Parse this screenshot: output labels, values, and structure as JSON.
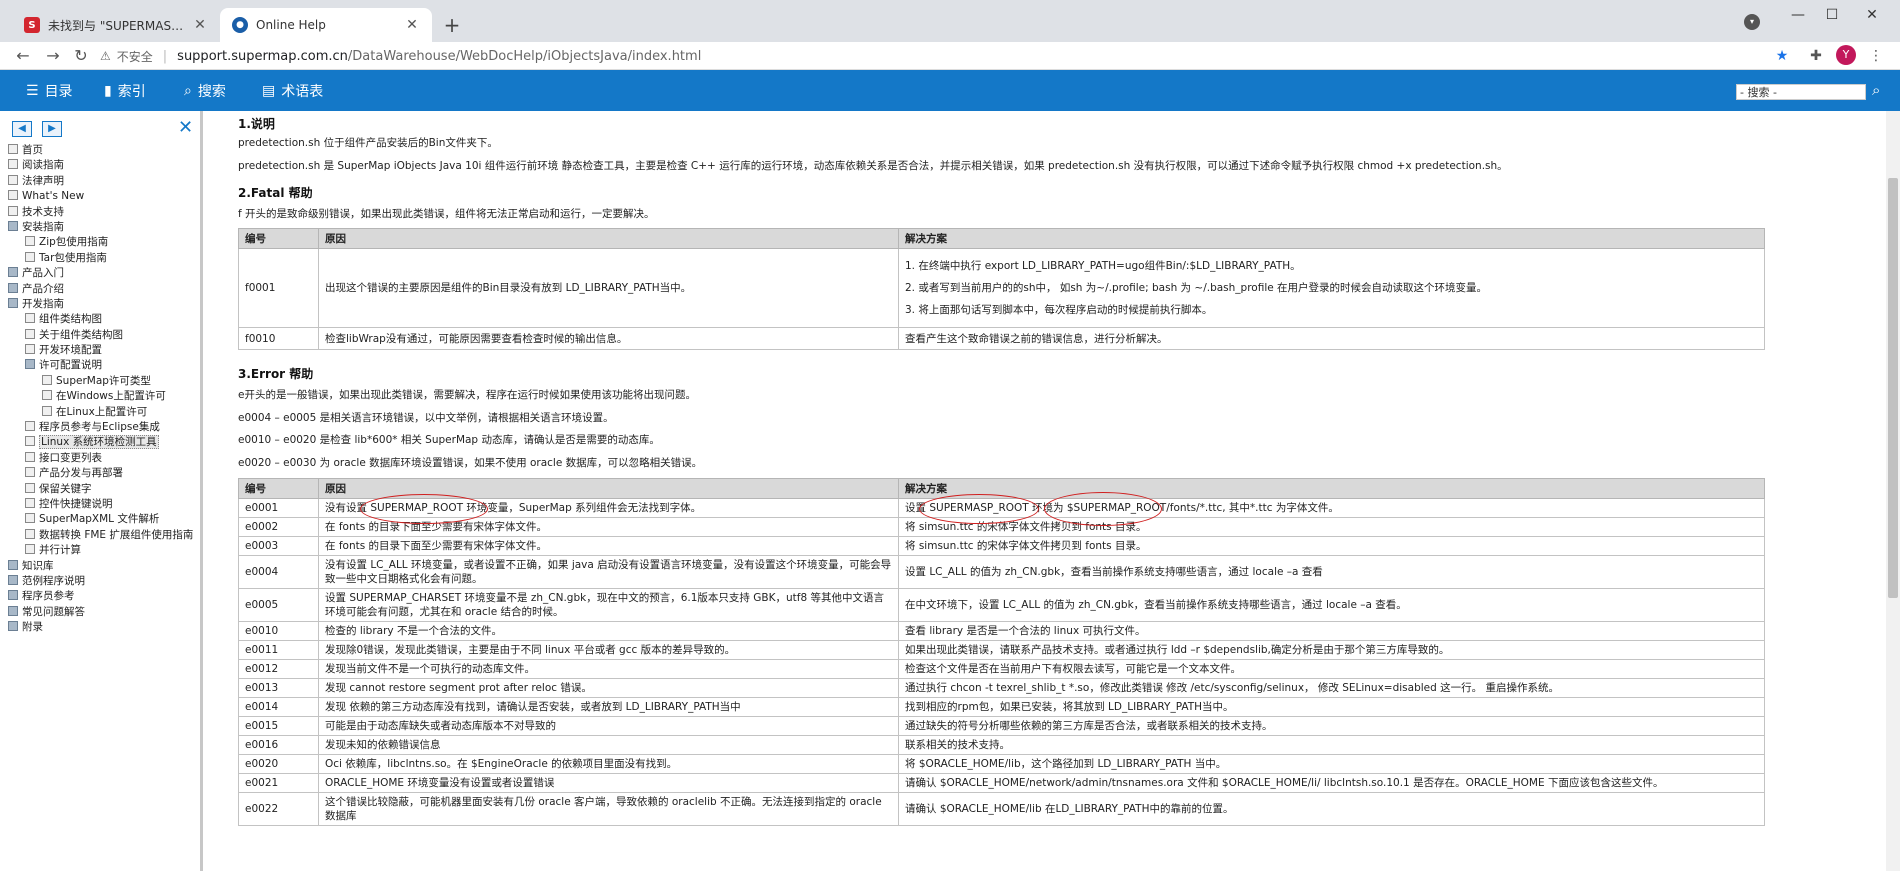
{
  "browser": {
    "tabs": [
      {
        "title": "未找到与 \"SUPERMASP_ROOT\"",
        "favicon": "S",
        "active": false
      },
      {
        "title": "Online Help",
        "favicon": "globe",
        "active": true
      }
    ],
    "new_tab": "+",
    "address": {
      "warning": "⚠",
      "not_secure": "不安全",
      "host": "support.supermap.com.cn",
      "path": "/DataWarehouse/WebDocHelp/iObjectsJava/index.html"
    },
    "avatar": "Y"
  },
  "helpbar": {
    "items": [
      {
        "icon": "☰",
        "label": "目录"
      },
      {
        "icon": "▮",
        "label": "索引"
      },
      {
        "icon": "⌕",
        "label": "搜索"
      },
      {
        "icon": "▤",
        "label": "术语表"
      }
    ],
    "search_value": "- 搜索 -"
  },
  "toc": {
    "items": [
      {
        "label": "首页",
        "level": 0,
        "type": "page"
      },
      {
        "label": "阅读指南",
        "level": 0,
        "type": "page"
      },
      {
        "label": "法律声明",
        "level": 0,
        "type": "page"
      },
      {
        "label": "What's New",
        "level": 0,
        "type": "page"
      },
      {
        "label": "技术支持",
        "level": 0,
        "type": "page"
      },
      {
        "label": "安装指南",
        "level": 0,
        "type": "book"
      },
      {
        "label": "Zip包使用指南",
        "level": 1,
        "type": "page"
      },
      {
        "label": "Tar包使用指南",
        "level": 1,
        "type": "page"
      },
      {
        "label": "产品入门",
        "level": 0,
        "type": "book"
      },
      {
        "label": "产品介绍",
        "level": 0,
        "type": "book"
      },
      {
        "label": "开发指南",
        "level": 0,
        "type": "book"
      },
      {
        "label": "组件类结构图",
        "level": 1,
        "type": "page"
      },
      {
        "label": "关于组件类结构图",
        "level": 1,
        "type": "page"
      },
      {
        "label": "开发环境配置",
        "level": 1,
        "type": "page"
      },
      {
        "label": "许可配置说明",
        "level": 1,
        "type": "book"
      },
      {
        "label": "SuperMap许可类型",
        "level": 2,
        "type": "page"
      },
      {
        "label": "在Windows上配置许可",
        "level": 2,
        "type": "page"
      },
      {
        "label": "在Linux上配置许可",
        "level": 2,
        "type": "page"
      },
      {
        "label": "程序员参考与Eclipse集成",
        "level": 1,
        "type": "page"
      },
      {
        "label": "Linux 系统环境检测工具",
        "level": 1,
        "type": "page",
        "selected": true
      },
      {
        "label": "接口变更列表",
        "level": 1,
        "type": "page"
      },
      {
        "label": "产品分发与再部署",
        "level": 1,
        "type": "page"
      },
      {
        "label": "保留关键字",
        "level": 1,
        "type": "page"
      },
      {
        "label": "控件快捷键说明",
        "level": 1,
        "type": "page"
      },
      {
        "label": "SuperMapXML 文件解析",
        "level": 1,
        "type": "page"
      },
      {
        "label": "数据转换 FME 扩展组件使用指南",
        "level": 1,
        "type": "page"
      },
      {
        "label": "并行计算",
        "level": 1,
        "type": "page"
      },
      {
        "label": "知识库",
        "level": 0,
        "type": "book"
      },
      {
        "label": "范例程序说明",
        "level": 0,
        "type": "book"
      },
      {
        "label": "程序员参考",
        "level": 0,
        "type": "book"
      },
      {
        "label": "常见问题解答",
        "level": 0,
        "type": "book"
      },
      {
        "label": "附录",
        "level": 0,
        "type": "book"
      }
    ]
  },
  "content": {
    "section1": {
      "heading": "1.说明",
      "p1": "predetection.sh 位于组件产品安装后的Bin文件夹下。",
      "p2": "predetection.sh 是 SuperMap iObjects Java 10i 组件运行前环境 静态检查工具，主要是检查 C++ 运行库的运行环境，动态库依赖关系是否合法，并提示相关错误，如果 predetection.sh 没有执行权限，可以通过下述命令赋予执行权限 chmod +x predetection.sh。"
    },
    "section2": {
      "heading": "2.Fatal 帮助",
      "p1": "f 开头的是致命级别错误，如果出现此类错误，组件将无法正常启动和运行，一定要解决。",
      "headers": [
        "编号",
        "原因",
        "解决方案"
      ],
      "rows": [
        {
          "code": "f0001",
          "reason": "出现这个错误的主要原因是组件的Bin目录没有放到 LD_LIBRARY_PATH当中。",
          "solutions": [
            "1. 在终端中执行 export LD_LIBRARY_PATH=ugo组件Bin/:$LD_LIBRARY_PATH。",
            "2. 或者写到当前用户的的sh中， 如sh 为~/.profile; bash 为 ~/.bash_profile 在用户登录的时候会自动读取这个环境变量。",
            "3. 将上面那句话写到脚本中，每次程序启动的时候提前执行脚本。"
          ]
        },
        {
          "code": "f0010",
          "reason": "检查libWrap没有通过，可能原因需要查看检查时候的输出信息。",
          "solutions": [
            "查看产生这个致命错误之前的错误信息，进行分析解决。"
          ]
        }
      ]
    },
    "section3": {
      "heading": "3.Error 帮助",
      "p1": "e开头的是一般错误，如果出现此类错误，需要解决，程序在运行时候如果使用该功能将出现问题。",
      "p2": "e0004 – e0005 是相关语言环境错误，以中文举例，请根据相关语言环境设置。",
      "p3": "e0010 – e0020 是检查 lib*600* 相关 SuperMap 动态库，请确认是否是需要的动态库。",
      "p4": "e0020 – e0030 为 oracle 数据库环境设置错误，如果不使用 oracle 数据库，可以忽略相关错误。",
      "headers": [
        "编号",
        "原因",
        "解决方案"
      ],
      "rows": [
        {
          "code": "e0001",
          "reason": "没有设置 SUPERMAP_ROOT 环境变量，SuperMap 系列组件会无法找到字体。",
          "solution": "设置 SUPERMASP_ROOT 环境为 $SUPERMAP_ROOT/fonts/*.ttc, 其中*.ttc 为字体文件。"
        },
        {
          "code": "e0002",
          "reason": "在 fonts 的目录下面至少需要有宋体字体文件。",
          "solution": "将 simsun.ttc 的宋体字体文件拷贝到 fonts 目录。"
        },
        {
          "code": "e0003",
          "reason": "在 fonts 的目录下面至少需要有宋体字体文件。",
          "solution": "将 simsun.ttc 的宋体字体文件拷贝到 fonts 目录。"
        },
        {
          "code": "e0004",
          "reason": "没有设置 LC_ALL 环境变量，或者设置不正确，如果 java 启动没有设置语言环境变量，没有设置这个环境变量，可能会导致一些中文日期格式化会有问题。",
          "solution": "设置 LC_ALL 的值为 zh_CN.gbk，查看当前操作系统支持哪些语言，通过 locale –a 查看"
        },
        {
          "code": "e0005",
          "reason": "设置 SUPERMAP_CHARSET 环境变量不是 zh_CN.gbk，现在中文的预言，6.1版本只支持 GBK，utf8 等其他中文语言环境可能会有问题，尤其在和 oracle 结合的时候。",
          "solution": "在中文环境下，设置 LC_ALL 的值为 zh_CN.gbk，查看当前操作系统支持哪些语言，通过 locale –a 查看。"
        },
        {
          "code": "e0010",
          "reason": "检查的 library 不是一个合法的文件。",
          "solution": "查看 library 是否是一个合法的 linux 可执行文件。"
        },
        {
          "code": "e0011",
          "reason": "发现除0错误，发现此类错误，主要是由于不同 linux 平台或者 gcc 版本的差异导致的。",
          "solution": "如果出现此类错误，请联系产品技术支持。或者通过执行 ldd –r $dependslib,确定分析是由于那个第三方库导致的。"
        },
        {
          "code": "e0012",
          "reason": "发现当前文件不是一个可执行的动态库文件。",
          "solution": "检查这个文件是否在当前用户下有权限去读写，可能它是一个文本文件。"
        },
        {
          "code": "e0013",
          "reason": "发现 cannot restore segment prot after reloc 错误。",
          "solution": "通过执行 chcon -t texrel_shlib_t *.so，修改此类错误 修改 /etc/sysconfig/selinux， 修改 SELinux=disabled 这一行。 重启操作系统。"
        },
        {
          "code": "e0014",
          "reason": "发现 依赖的第三方动态库没有找到，请确认是否安装，或者放到 LD_LIBRARY_PATH当中",
          "solution": "找到相应的rpm包，如果已安装，将其放到 LD_LIBRARY_PATH当中。"
        },
        {
          "code": "e0015",
          "reason": "可能是由于动态库缺失或者动态库版本不对导致的",
          "solution": "通过缺失的符号分析哪些依赖的第三方库是否合法，或者联系相关的技术支持。"
        },
        {
          "code": "e0016",
          "reason": "发现未知的依赖错误信息",
          "solution": "联系相关的技术支持。"
        },
        {
          "code": "e0020",
          "reason": "Oci 依赖库，libclntns.so。在 $EngineOracle 的依赖项目里面没有找到。",
          "solution": "将 $ORACLE_HOME/lib，这个路径加到 LD_LIBRARY_PATH 当中。"
        },
        {
          "code": "e0021",
          "reason": "ORACLE_HOME 环境变量没有设置或者设置错误",
          "solution": "请确认 $ORACLE_HOME/network/admin/tnsnames.ora 文件和 $ORACLE_HOME/li/ libclntsh.so.10.1 是否存在。ORACLE_HOME 下面应该包含这些文件。"
        },
        {
          "code": "e0022",
          "reason": "这个错误比较隐蔽，可能机器里面安装有几份 oracle 客户端，导致依赖的 oraclelib 不正确。无法连接到指定的 oracle 数据库",
          "solution": "请确认 $ORACLE_HOME/lib 在LD_LIBRARY_PATH中的靠前的位置。"
        }
      ]
    }
  }
}
